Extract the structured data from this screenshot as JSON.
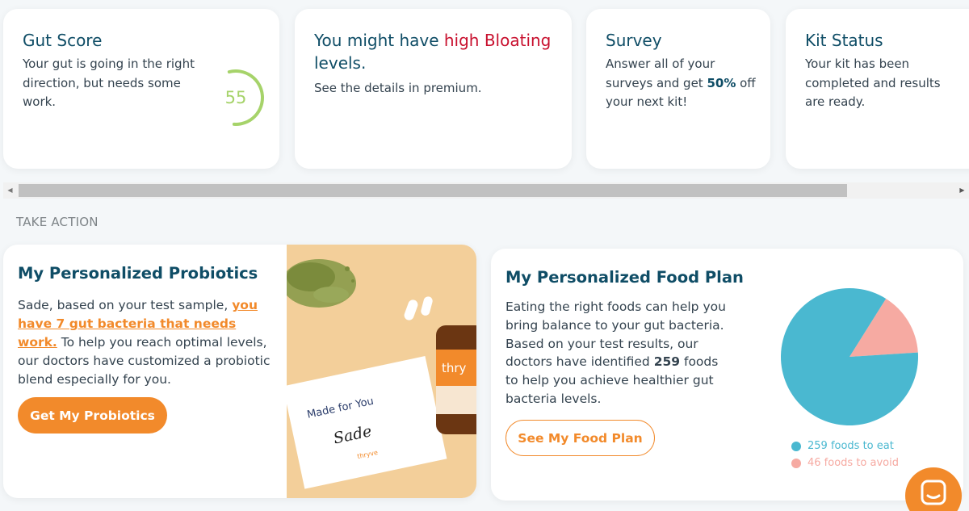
{
  "colors": {
    "accent_orange": "#f28a2b",
    "title_blue": "#0f4d66",
    "alert_red": "#c8102e",
    "gauge_green": "#a6d36a",
    "pie_teal": "#4ab8d0",
    "pie_pink": "#f6aaa2"
  },
  "cards": {
    "gut": {
      "title": "Gut Score",
      "body": "Your gut is going in the right direction, but needs some work.",
      "score": "55",
      "score_fraction": 0.55
    },
    "bloat": {
      "title_prefix": "You might have ",
      "title_highlight": "high Bloating",
      "title_suffix": "levels.",
      "body": "See the details in premium."
    },
    "survey": {
      "title": "Survey",
      "body_prefix": "Answer all of your surveys and get ",
      "body_bold": "50%",
      "body_suffix": " off your next kit!"
    },
    "kit": {
      "title": "Kit Status",
      "body": "Your kit has been completed and results are ready."
    }
  },
  "scrollbar": {
    "left_arrow": "◀",
    "right_arrow": "▶"
  },
  "section": {
    "take_action": "TAKE ACTION"
  },
  "probiotics": {
    "title": "My Personalized Probiotics",
    "body_prefix": "Sade, based on your test sample, ",
    "body_link": "you have 7 gut bacteria that needs work.",
    "body_suffix": " To help you reach optimal levels, our doctors have customized a probiotic blend especially for you.",
    "button": "Get My Probiotics",
    "photo": {
      "card_heading": "Made for You",
      "card_name": "Sade",
      "card_brand": "thryve",
      "bottle_label": "thry"
    }
  },
  "food_plan": {
    "title": "My Personalized Food Plan",
    "body_prefix": "Eating the right foods can help you bring balance to your gut bacteria. Based on your test results, our doctors have identified ",
    "body_bold": "259",
    "body_suffix": " foods to help you achieve healthier gut bacteria levels.",
    "button": "See My Food Plan",
    "legend_eat": "259 foods to eat",
    "legend_avoid": "46 foods to avoid"
  },
  "chart_data": {
    "type": "pie",
    "categories": [
      "259 foods to eat",
      "46 foods to avoid"
    ],
    "values": [
      259,
      46
    ],
    "colors": [
      "#4ab8d0",
      "#f6aaa2"
    ],
    "legend_placement": "bottom"
  },
  "chat": {
    "icon": "chat-icon"
  }
}
